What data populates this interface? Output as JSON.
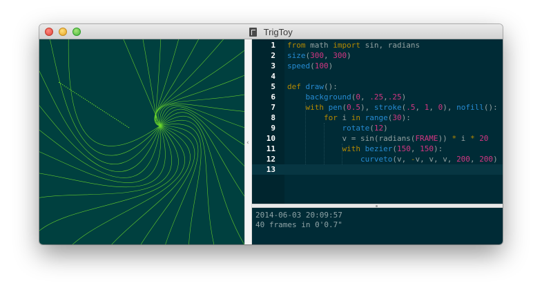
{
  "window": {
    "title": "TrigToy"
  },
  "colors": {
    "canvas_bg": "#00403f",
    "curve": "#6fdc2a",
    "editor_bg": "#002b36",
    "keyword": "#b58900",
    "function": "#268bd2",
    "number": "#d33682"
  },
  "editor": {
    "active_line": 13,
    "lines": [
      {
        "n": "1",
        "tokens": [
          {
            "t": "from",
            "c": "kw"
          },
          {
            "t": " math ",
            "c": "id"
          },
          {
            "t": "import",
            "c": "kw"
          },
          {
            "t": " sin, radians",
            "c": "id"
          }
        ]
      },
      {
        "n": "2",
        "tokens": [
          {
            "t": "size",
            "c": "fn"
          },
          {
            "t": "(",
            "c": "id"
          },
          {
            "t": "300",
            "c": "num"
          },
          {
            "t": ", ",
            "c": "id"
          },
          {
            "t": "300",
            "c": "num"
          },
          {
            "t": ")",
            "c": "id"
          }
        ]
      },
      {
        "n": "3",
        "tokens": [
          {
            "t": "speed",
            "c": "fn"
          },
          {
            "t": "(",
            "c": "id"
          },
          {
            "t": "100",
            "c": "num"
          },
          {
            "t": ")",
            "c": "id"
          }
        ]
      },
      {
        "n": "4",
        "tokens": []
      },
      {
        "n": "5",
        "tokens": [
          {
            "t": "def",
            "c": "kw"
          },
          {
            "t": " ",
            "c": "id"
          },
          {
            "t": "draw",
            "c": "fn"
          },
          {
            "t": "():",
            "c": "id"
          }
        ]
      },
      {
        "n": "6",
        "tokens": [
          {
            "t": "    ",
            "c": "id"
          },
          {
            "t": "background",
            "c": "fn"
          },
          {
            "t": "(",
            "c": "id"
          },
          {
            "t": "0",
            "c": "num"
          },
          {
            "t": ", ",
            "c": "id"
          },
          {
            "t": ".25",
            "c": "num"
          },
          {
            "t": ",",
            "c": "id"
          },
          {
            "t": ".25",
            "c": "num"
          },
          {
            "t": ")",
            "c": "id"
          }
        ]
      },
      {
        "n": "7",
        "tokens": [
          {
            "t": "    ",
            "c": "id"
          },
          {
            "t": "with",
            "c": "kw"
          },
          {
            "t": " ",
            "c": "id"
          },
          {
            "t": "pen",
            "c": "fn"
          },
          {
            "t": "(",
            "c": "id"
          },
          {
            "t": "0.5",
            "c": "num"
          },
          {
            "t": "), ",
            "c": "id"
          },
          {
            "t": "stroke",
            "c": "fn"
          },
          {
            "t": "(",
            "c": "id"
          },
          {
            "t": ".5",
            "c": "num"
          },
          {
            "t": ", ",
            "c": "id"
          },
          {
            "t": "1",
            "c": "num"
          },
          {
            "t": ", ",
            "c": "id"
          },
          {
            "t": "0",
            "c": "num"
          },
          {
            "t": "), ",
            "c": "id"
          },
          {
            "t": "nofill",
            "c": "fn"
          },
          {
            "t": "():",
            "c": "id"
          }
        ]
      },
      {
        "n": "8",
        "tokens": [
          {
            "t": "        ",
            "c": "id"
          },
          {
            "t": "for",
            "c": "kw"
          },
          {
            "t": " i ",
            "c": "id"
          },
          {
            "t": "in",
            "c": "kw"
          },
          {
            "t": " ",
            "c": "id"
          },
          {
            "t": "range",
            "c": "fn"
          },
          {
            "t": "(",
            "c": "id"
          },
          {
            "t": "30",
            "c": "num"
          },
          {
            "t": "):",
            "c": "id"
          }
        ]
      },
      {
        "n": "9",
        "tokens": [
          {
            "t": "            ",
            "c": "id"
          },
          {
            "t": "rotate",
            "c": "fn"
          },
          {
            "t": "(",
            "c": "id"
          },
          {
            "t": "12",
            "c": "num"
          },
          {
            "t": ")",
            "c": "id"
          }
        ]
      },
      {
        "n": "10",
        "tokens": [
          {
            "t": "            v = sin(radians(",
            "c": "id"
          },
          {
            "t": "FRAME",
            "c": "num"
          },
          {
            "t": ")) ",
            "c": "id"
          },
          {
            "t": "*",
            "c": "op"
          },
          {
            "t": " i ",
            "c": "id"
          },
          {
            "t": "*",
            "c": "op"
          },
          {
            "t": " ",
            "c": "id"
          },
          {
            "t": "20",
            "c": "num"
          }
        ]
      },
      {
        "n": "11",
        "tokens": [
          {
            "t": "            ",
            "c": "id"
          },
          {
            "t": "with",
            "c": "kw"
          },
          {
            "t": " ",
            "c": "id"
          },
          {
            "t": "bezier",
            "c": "fn"
          },
          {
            "t": "(",
            "c": "id"
          },
          {
            "t": "150",
            "c": "num"
          },
          {
            "t": ", ",
            "c": "id"
          },
          {
            "t": "150",
            "c": "num"
          },
          {
            "t": "):",
            "c": "id"
          }
        ]
      },
      {
        "n": "12",
        "tokens": [
          {
            "t": "                ",
            "c": "id"
          },
          {
            "t": "curveto",
            "c": "fn"
          },
          {
            "t": "(v, ",
            "c": "id"
          },
          {
            "t": "-",
            "c": "op"
          },
          {
            "t": "v, v, v, ",
            "c": "id"
          },
          {
            "t": "200",
            "c": "num"
          },
          {
            "t": ", ",
            "c": "id"
          },
          {
            "t": "200",
            "c": "num"
          },
          {
            "t": ")",
            "c": "id"
          }
        ]
      },
      {
        "n": "13",
        "tokens": []
      }
    ]
  },
  "console": {
    "timestamp": "2014-06-03 20:09:57",
    "status": "40 frames in 0'0.7\""
  },
  "icons": {
    "title_doc": "document-icon",
    "split_grip": "resize-grip-icon"
  }
}
